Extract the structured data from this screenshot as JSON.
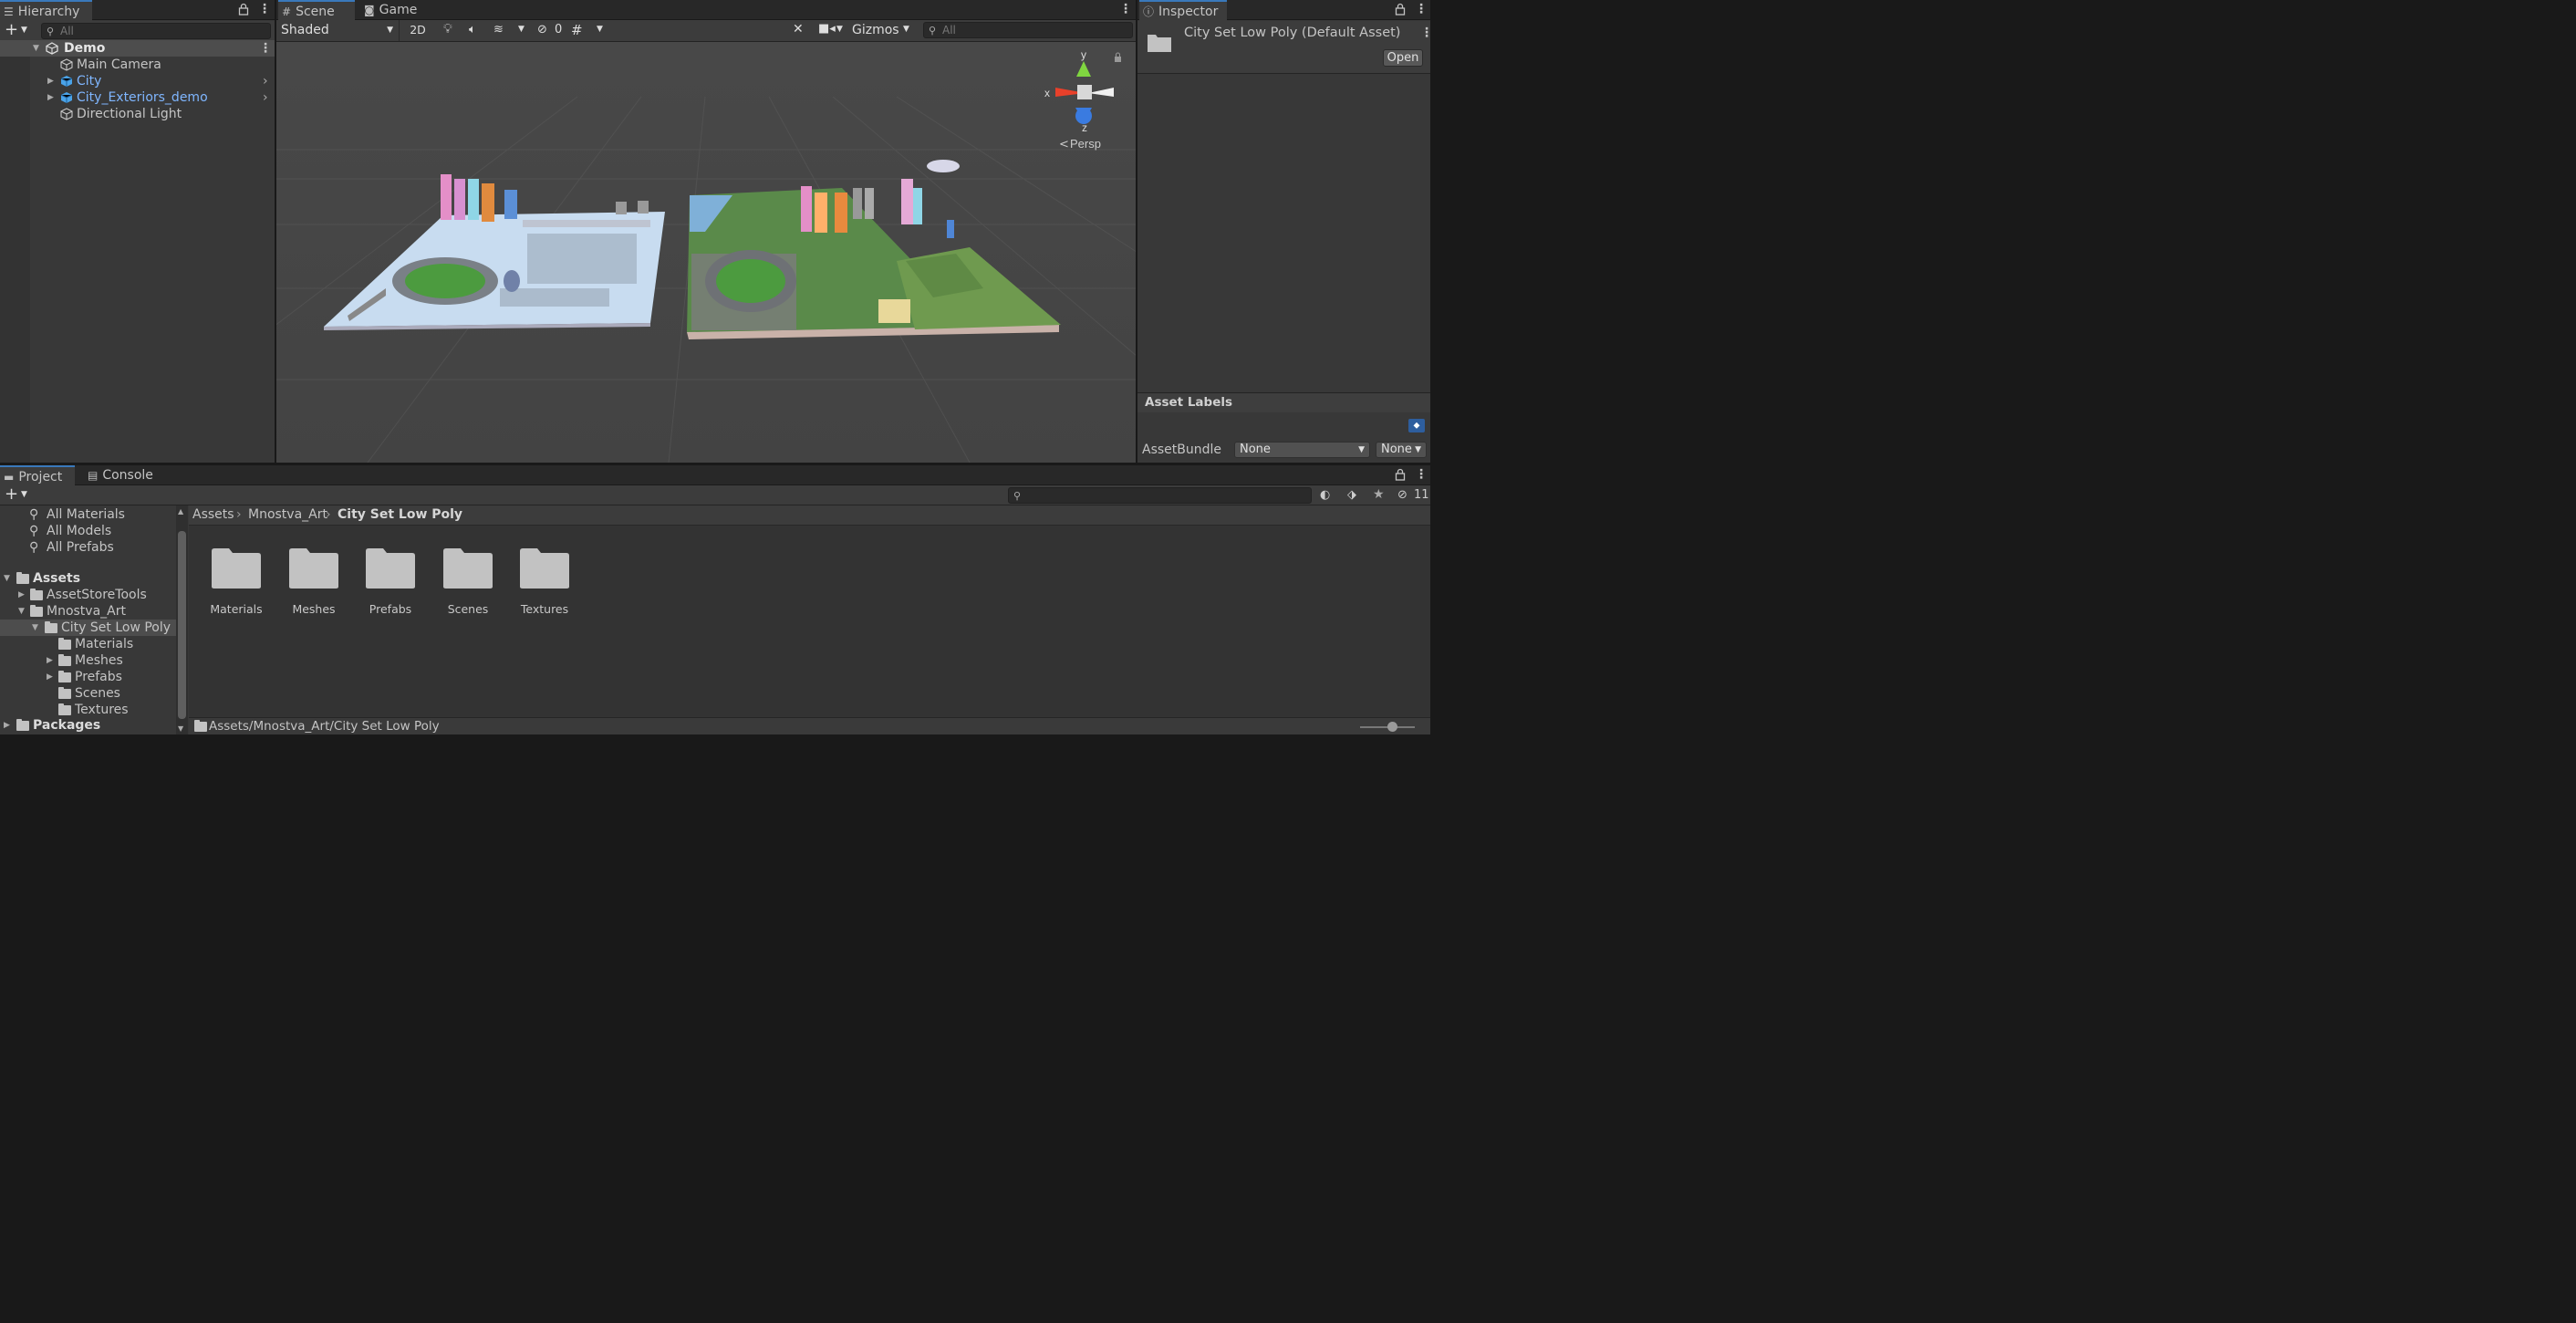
{
  "hierarchy": {
    "tab": "Hierarchy",
    "search_placeholder": "All",
    "scene": "Demo",
    "items": [
      "Main Camera",
      "City",
      "City_Exteriors_demo",
      "Directional Light"
    ]
  },
  "scene_view": {
    "tabs": [
      "Scene",
      "Game"
    ],
    "shading": "Shaded",
    "mode_2d": "2D",
    "hidden_count": "0",
    "gizmos": "Gizmos",
    "search_placeholder": "All",
    "gizmo": {
      "x": "x",
      "y": "y",
      "z": "z",
      "projection": "Persp"
    }
  },
  "inspector": {
    "tab": "Inspector",
    "asset_title": "City Set Low Poly (Default Asset)",
    "open_button": "Open",
    "asset_labels": "Asset Labels",
    "assetbundle_label": "AssetBundle",
    "assetbundle_value": "None",
    "variant_value": "None"
  },
  "project": {
    "tabs": [
      "Project",
      "Console"
    ],
    "hidden_count": "11",
    "favorites": [
      "All Materials",
      "All Models",
      "All Prefabs"
    ],
    "tree": [
      {
        "label": "Assets",
        "bold": true
      },
      {
        "label": "AssetStoreTools"
      },
      {
        "label": "Mnostva_Art"
      },
      {
        "label": "City Set Low Poly",
        "selected": true
      },
      {
        "label": "Materials"
      },
      {
        "label": "Meshes"
      },
      {
        "label": "Prefabs"
      },
      {
        "label": "Scenes"
      },
      {
        "label": "Textures"
      },
      {
        "label": "Packages",
        "bold": true
      }
    ],
    "breadcrumb": [
      "Assets",
      "Mnostva_Art",
      "City Set Low Poly"
    ],
    "folders": [
      "Materials",
      "Meshes",
      "Prefabs",
      "Scenes",
      "Textures"
    ],
    "footer_path": "Assets/Mnostva_Art/City Set Low Poly"
  },
  "colors": {
    "panel": "#383838",
    "tabbar": "#282828",
    "selection": "#4d4d4d",
    "link_blue": "#7fb6ff",
    "scene_bg": "#454545"
  }
}
